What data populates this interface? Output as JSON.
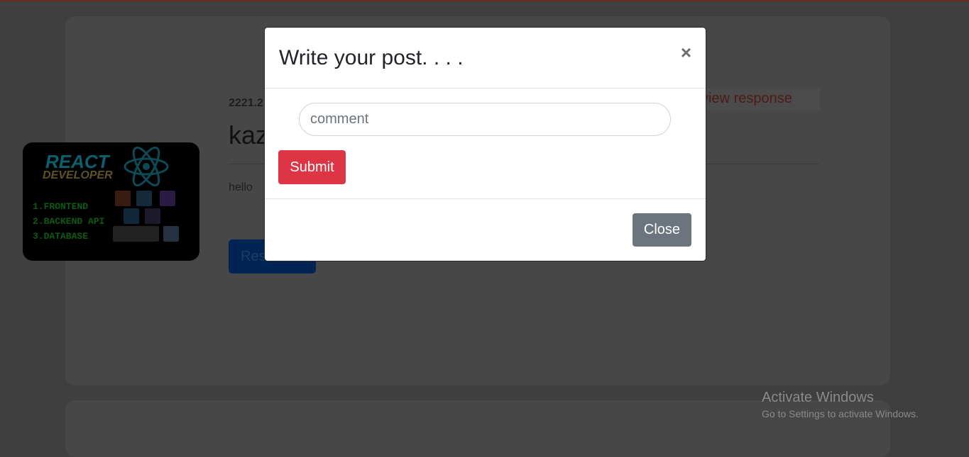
{
  "post": {
    "date": "2221.2",
    "author": "kaz",
    "body": "hello",
    "respond_label": "Res",
    "view_response_label": "view response",
    "image_text": {
      "title": "REACT",
      "subtitle": "DEVELOPER",
      "items": [
        "1.FRONTEND",
        "2.BACKEND API",
        "3.DATABASE"
      ]
    }
  },
  "modal": {
    "title": "Write your post. . . .",
    "close_icon": "×",
    "comment_placeholder": "comment",
    "comment_value": "",
    "submit_label": "Submit",
    "close_label": "Close"
  },
  "watermark": {
    "title": "Activate Windows",
    "subtitle": "Go to Settings to activate Windows."
  },
  "colors": {
    "danger": "#dc3545",
    "secondary": "#6c757d",
    "primary": "#007bff"
  }
}
